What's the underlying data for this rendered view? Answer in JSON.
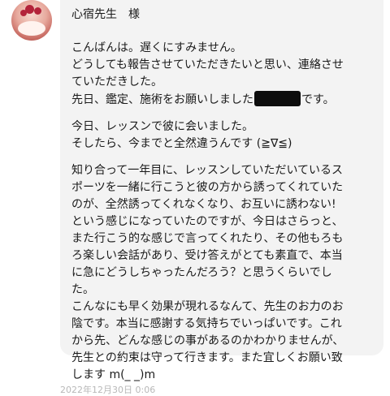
{
  "message": {
    "recipient": "心宿先生　様",
    "lines_top": [
      "こんばんは。遅くにすみません。",
      "どうしても報告させていただきたいと思い、連絡させ",
      "ていただきした。"
    ],
    "redacted_line": {
      "before": "先日、鑑定、施術をお願いしました",
      "after": "です。"
    },
    "lines_bottom": [
      "今日、レッスンで彼に会いました。",
      "そしたら、今までと全然違うんです (≧∇≦)",
      "知り合って一年目に、レッスンしていただいているス",
      "ポーツを一緒に行こうと彼の方から誘ってくれていた",
      "のが、全然誘ってくれなくなり、お互いに誘わない!",
      "という感じになっていたのですが、今日はさらっと、",
      "また行こう的な感じで言ってくれたり、その他もろも",
      "ろ楽しい会話があり、受け答えがとても素直で、本当",
      "に急にどうしちゃったんだろう？と思うくらいでし",
      "た。",
      "こんなにも早く効果が現れるなんて、先生のお力のお",
      "陰です。本当に感謝する気持ちでいっぱいです。これ",
      "から先、どんな感じの事があるのかわかりませんが、",
      "先生との約束は守って行きます。また宜しくお願い致",
      "します m(_ _)m"
    ]
  },
  "timestamp": "2022年12月30日 0:06"
}
